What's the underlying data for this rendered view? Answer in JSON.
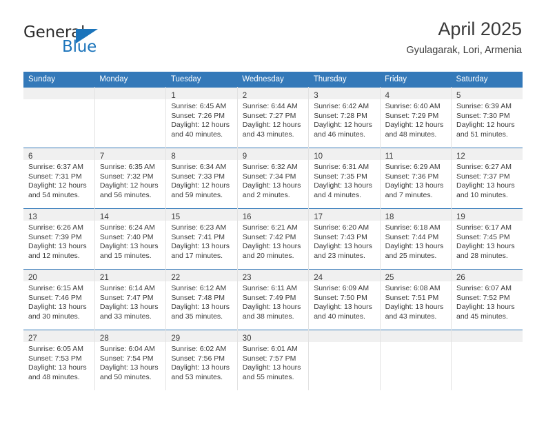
{
  "brand": {
    "name_part1": "General",
    "name_part2": "Blue",
    "triangle_icon": "blue-triangle-icon",
    "color_dark": "#2b2b2b",
    "color_blue": "#1b74bb"
  },
  "header": {
    "title": "April 2025",
    "subtitle": "Gyulagarak, Lori, Armenia"
  },
  "theme": {
    "header_blue": "#3479b9",
    "daynum_strip": "#f0f0f0",
    "cell_border": "#e2e2e2",
    "text": "#3b3b3b"
  },
  "weekdays": [
    "Sunday",
    "Monday",
    "Tuesday",
    "Wednesday",
    "Thursday",
    "Friday",
    "Saturday"
  ],
  "weeks": [
    [
      {
        "day": "",
        "sunrise": "",
        "sunset": "",
        "daylight_1": "",
        "daylight_2": ""
      },
      {
        "day": "",
        "sunrise": "",
        "sunset": "",
        "daylight_1": "",
        "daylight_2": ""
      },
      {
        "day": "1",
        "sunrise": "Sunrise: 6:45 AM",
        "sunset": "Sunset: 7:26 PM",
        "daylight_1": "Daylight: 12 hours",
        "daylight_2": "and 40 minutes."
      },
      {
        "day": "2",
        "sunrise": "Sunrise: 6:44 AM",
        "sunset": "Sunset: 7:27 PM",
        "daylight_1": "Daylight: 12 hours",
        "daylight_2": "and 43 minutes."
      },
      {
        "day": "3",
        "sunrise": "Sunrise: 6:42 AM",
        "sunset": "Sunset: 7:28 PM",
        "daylight_1": "Daylight: 12 hours",
        "daylight_2": "and 46 minutes."
      },
      {
        "day": "4",
        "sunrise": "Sunrise: 6:40 AM",
        "sunset": "Sunset: 7:29 PM",
        "daylight_1": "Daylight: 12 hours",
        "daylight_2": "and 48 minutes."
      },
      {
        "day": "5",
        "sunrise": "Sunrise: 6:39 AM",
        "sunset": "Sunset: 7:30 PM",
        "daylight_1": "Daylight: 12 hours",
        "daylight_2": "and 51 minutes."
      }
    ],
    [
      {
        "day": "6",
        "sunrise": "Sunrise: 6:37 AM",
        "sunset": "Sunset: 7:31 PM",
        "daylight_1": "Daylight: 12 hours",
        "daylight_2": "and 54 minutes."
      },
      {
        "day": "7",
        "sunrise": "Sunrise: 6:35 AM",
        "sunset": "Sunset: 7:32 PM",
        "daylight_1": "Daylight: 12 hours",
        "daylight_2": "and 56 minutes."
      },
      {
        "day": "8",
        "sunrise": "Sunrise: 6:34 AM",
        "sunset": "Sunset: 7:33 PM",
        "daylight_1": "Daylight: 12 hours",
        "daylight_2": "and 59 minutes."
      },
      {
        "day": "9",
        "sunrise": "Sunrise: 6:32 AM",
        "sunset": "Sunset: 7:34 PM",
        "daylight_1": "Daylight: 13 hours",
        "daylight_2": "and 2 minutes."
      },
      {
        "day": "10",
        "sunrise": "Sunrise: 6:31 AM",
        "sunset": "Sunset: 7:35 PM",
        "daylight_1": "Daylight: 13 hours",
        "daylight_2": "and 4 minutes."
      },
      {
        "day": "11",
        "sunrise": "Sunrise: 6:29 AM",
        "sunset": "Sunset: 7:36 PM",
        "daylight_1": "Daylight: 13 hours",
        "daylight_2": "and 7 minutes."
      },
      {
        "day": "12",
        "sunrise": "Sunrise: 6:27 AM",
        "sunset": "Sunset: 7:37 PM",
        "daylight_1": "Daylight: 13 hours",
        "daylight_2": "and 10 minutes."
      }
    ],
    [
      {
        "day": "13",
        "sunrise": "Sunrise: 6:26 AM",
        "sunset": "Sunset: 7:39 PM",
        "daylight_1": "Daylight: 13 hours",
        "daylight_2": "and 12 minutes."
      },
      {
        "day": "14",
        "sunrise": "Sunrise: 6:24 AM",
        "sunset": "Sunset: 7:40 PM",
        "daylight_1": "Daylight: 13 hours",
        "daylight_2": "and 15 minutes."
      },
      {
        "day": "15",
        "sunrise": "Sunrise: 6:23 AM",
        "sunset": "Sunset: 7:41 PM",
        "daylight_1": "Daylight: 13 hours",
        "daylight_2": "and 17 minutes."
      },
      {
        "day": "16",
        "sunrise": "Sunrise: 6:21 AM",
        "sunset": "Sunset: 7:42 PM",
        "daylight_1": "Daylight: 13 hours",
        "daylight_2": "and 20 minutes."
      },
      {
        "day": "17",
        "sunrise": "Sunrise: 6:20 AM",
        "sunset": "Sunset: 7:43 PM",
        "daylight_1": "Daylight: 13 hours",
        "daylight_2": "and 23 minutes."
      },
      {
        "day": "18",
        "sunrise": "Sunrise: 6:18 AM",
        "sunset": "Sunset: 7:44 PM",
        "daylight_1": "Daylight: 13 hours",
        "daylight_2": "and 25 minutes."
      },
      {
        "day": "19",
        "sunrise": "Sunrise: 6:17 AM",
        "sunset": "Sunset: 7:45 PM",
        "daylight_1": "Daylight: 13 hours",
        "daylight_2": "and 28 minutes."
      }
    ],
    [
      {
        "day": "20",
        "sunrise": "Sunrise: 6:15 AM",
        "sunset": "Sunset: 7:46 PM",
        "daylight_1": "Daylight: 13 hours",
        "daylight_2": "and 30 minutes."
      },
      {
        "day": "21",
        "sunrise": "Sunrise: 6:14 AM",
        "sunset": "Sunset: 7:47 PM",
        "daylight_1": "Daylight: 13 hours",
        "daylight_2": "and 33 minutes."
      },
      {
        "day": "22",
        "sunrise": "Sunrise: 6:12 AM",
        "sunset": "Sunset: 7:48 PM",
        "daylight_1": "Daylight: 13 hours",
        "daylight_2": "and 35 minutes."
      },
      {
        "day": "23",
        "sunrise": "Sunrise: 6:11 AM",
        "sunset": "Sunset: 7:49 PM",
        "daylight_1": "Daylight: 13 hours",
        "daylight_2": "and 38 minutes."
      },
      {
        "day": "24",
        "sunrise": "Sunrise: 6:09 AM",
        "sunset": "Sunset: 7:50 PM",
        "daylight_1": "Daylight: 13 hours",
        "daylight_2": "and 40 minutes."
      },
      {
        "day": "25",
        "sunrise": "Sunrise: 6:08 AM",
        "sunset": "Sunset: 7:51 PM",
        "daylight_1": "Daylight: 13 hours",
        "daylight_2": "and 43 minutes."
      },
      {
        "day": "26",
        "sunrise": "Sunrise: 6:07 AM",
        "sunset": "Sunset: 7:52 PM",
        "daylight_1": "Daylight: 13 hours",
        "daylight_2": "and 45 minutes."
      }
    ],
    [
      {
        "day": "27",
        "sunrise": "Sunrise: 6:05 AM",
        "sunset": "Sunset: 7:53 PM",
        "daylight_1": "Daylight: 13 hours",
        "daylight_2": "and 48 minutes."
      },
      {
        "day": "28",
        "sunrise": "Sunrise: 6:04 AM",
        "sunset": "Sunset: 7:54 PM",
        "daylight_1": "Daylight: 13 hours",
        "daylight_2": "and 50 minutes."
      },
      {
        "day": "29",
        "sunrise": "Sunrise: 6:02 AM",
        "sunset": "Sunset: 7:56 PM",
        "daylight_1": "Daylight: 13 hours",
        "daylight_2": "and 53 minutes."
      },
      {
        "day": "30",
        "sunrise": "Sunrise: 6:01 AM",
        "sunset": "Sunset: 7:57 PM",
        "daylight_1": "Daylight: 13 hours",
        "daylight_2": "and 55 minutes."
      },
      {
        "day": "",
        "sunrise": "",
        "sunset": "",
        "daylight_1": "",
        "daylight_2": ""
      },
      {
        "day": "",
        "sunrise": "",
        "sunset": "",
        "daylight_1": "",
        "daylight_2": ""
      },
      {
        "day": "",
        "sunrise": "",
        "sunset": "",
        "daylight_1": "",
        "daylight_2": ""
      }
    ]
  ]
}
